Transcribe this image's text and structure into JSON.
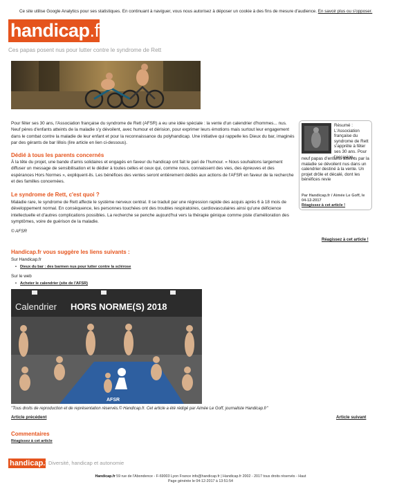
{
  "cookie": {
    "text": "Ce site utilise Google Analytics pour ses statistiques. En continuant à naviguer, vous nous autorisez à déposer un cookie à des fins de mesure d'audience.",
    "link": "En savoir plus ou s'opposer."
  },
  "logo": {
    "name": "handicap",
    "tld": ".fr"
  },
  "article": {
    "subtitle": "Ces papas posent nus pour lutter contre le syndrome de Rett",
    "intro": "Pour fêter ses 30 ans, l'Association française du syndrome de Rett (AFSR) a eu une idée spéciale : la vente d'un calendrier d'hommes... nus. Neuf pères d'enfants atteints de la maladie s'y dévoilent, avec humour et dérision, pour exprimer leurs émotions mais surtout leur engagement dans le combat contre la maladie de leur enfant et pour la reconnaissance du polyhandicap. Une initiative qui rappelle les Dieux du bar, imaginés par des gérants de bar lillois (lire article en lien ci-dessous).",
    "heading1": "Dédié à tous les parents concernés",
    "para1": "À la tête du projet, une bande d'amis solidaires et engagés en faveur du handicap ont fait le pari de l'humour. « Nous souhaitons largement diffuser un message de sensibilisation et le dédier à toutes celles et ceux qui, comme nous, connaissent des vies, des épreuves et des espérances Hors Normes », expliquent-ils. Les bénéfices des ventes seront entièrement dédiés aux actions de l'AFSR en faveur de la recherche et des familles concernées.",
    "heading2": "Le syndrome de Rett, c'est quoi ?",
    "para2": "Maladie rare, le syndrome de Rett affecte le système nerveux central. Il se traduit par une régression rapide des acquis après 6 à 18 mois de développement normal. En conséquence, les personnes touchées ont des troubles respiratoires, cardiovasculaires ainsi qu'une déficience intellectuelle et d'autres complications possibles. La recherche se penche aujourd'hui vers la thérapie génique comme piste d'amélioration des symptômes, voire de guérison de la maladie.",
    "credit": "© AFSR",
    "react": "Réagissez à cet article !"
  },
  "summary": {
    "resume": "Résumé : L'Association française du syndrome de Rett s'apprête à fêter ses 30 ans. Pour l'occasion,",
    "resume2": "neuf papas d'enfants atteints par la maladie se dévoilent nus dans un calendrier destiné à la vente. Un projet drôle et décalé, dont les bénéfices revie",
    "byline": "Par Handicap.fr / Aimée Le Goff, le 04-12-2017",
    "react": "Réagissez à cet article !"
  },
  "links": {
    "heading": "Handicap.fr vous suggère les liens suivants :",
    "site_label": "Sur Handicap.fr",
    "site_link": "Dieux du bar : des barmen nus pour lutter contre la sclérose",
    "web_label": "Sur le web",
    "web_link": "Acheter le calendrier (site de l'AFSR)"
  },
  "poster": {
    "title_a": "Calendrier",
    "title_b": "HORS NORME(S) 2018",
    "watermark": "AFSR"
  },
  "rights": "\"Tous droits de reproduction et de représentation réservés.© Handicap.fr. Cet article a été rédigé par Aimée Le Goff, journaliste Handicap.fr\"",
  "nav": {
    "prev": "Article précédent",
    "next": "Article suivant"
  },
  "comments": {
    "heading": "Commentaires",
    "react": "Réagissez à cet article"
  },
  "footer": {
    "logo": "handicap.fr",
    "tagline": "Diversité, handicap et autonomie",
    "brand": "Handicap.fr",
    "line1": "59 rue de l'Abondence - F-69003 Lyon France info@handicap.fr | Handicap.fr 2002 - 2017 tous droits réservés - Haut",
    "line2": "Page générée le 04-12-2017 à 13:51:54"
  }
}
